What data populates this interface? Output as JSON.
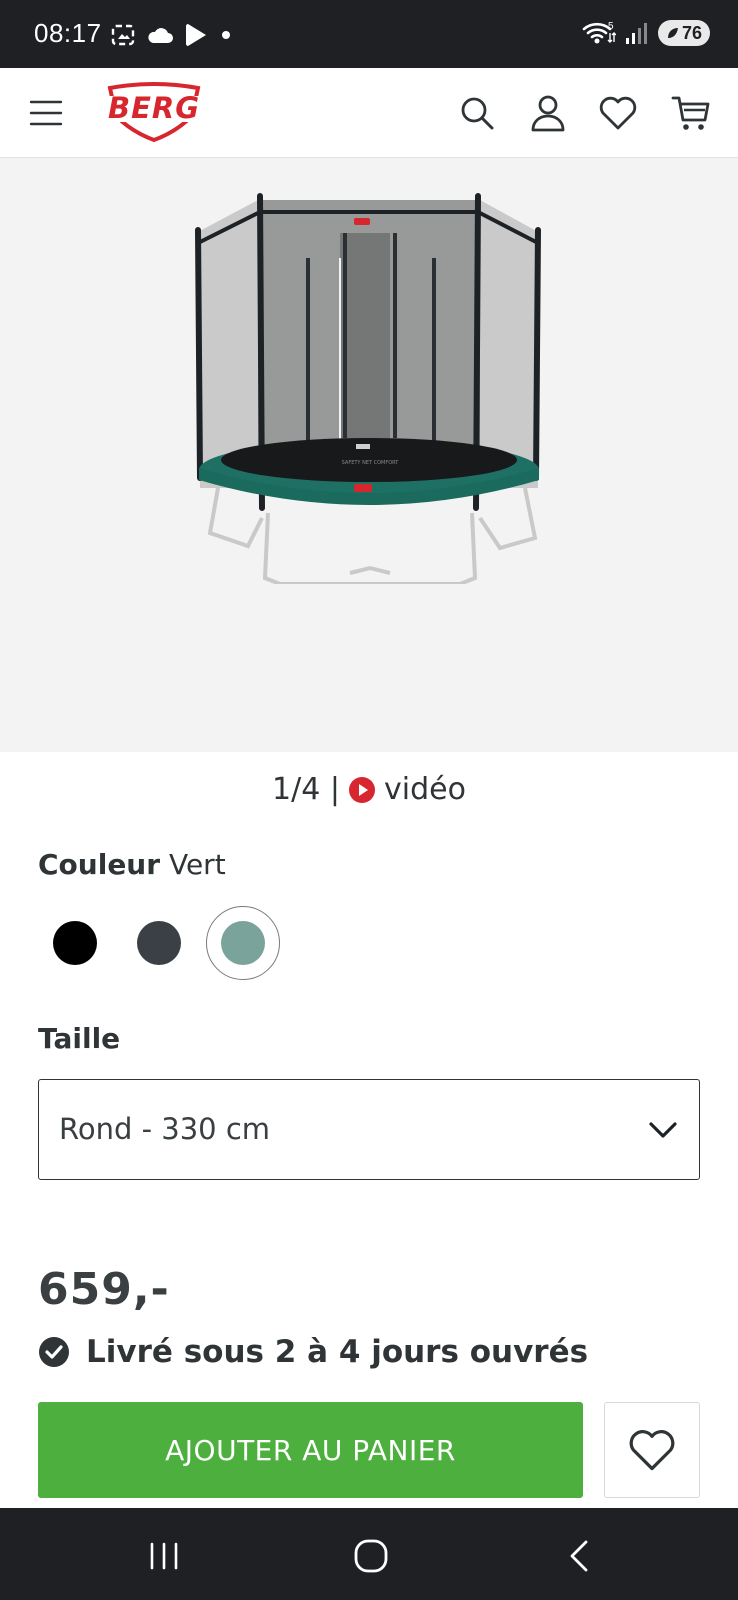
{
  "status_bar": {
    "time": "08:17",
    "battery": "76",
    "icons": [
      "screenshot-icon",
      "cloud-icon",
      "play-store-icon",
      "dot-icon",
      "wifi-icon",
      "signal-icon",
      "battery-icon"
    ]
  },
  "header": {
    "logo_text": "BERG",
    "icons": [
      "menu-icon",
      "search-icon",
      "account-icon",
      "heart-icon",
      "cart-icon"
    ]
  },
  "gallery": {
    "counter": "1/4 |",
    "video_label": "vidéo"
  },
  "color": {
    "label": "Couleur",
    "value": "Vert",
    "swatches": [
      {
        "name": "Noir",
        "hex": "#000000"
      },
      {
        "name": "Gris",
        "hex": "#3a4045"
      },
      {
        "name": "Vert",
        "hex": "#7aa39b",
        "selected": true
      }
    ]
  },
  "size": {
    "label": "Taille",
    "selected": "Rond - 330 cm"
  },
  "price": "659,-",
  "delivery": "Livré sous 2 à 4 jours ouvrés",
  "cta": {
    "add_to_cart": "AJOUTER AU PANIER"
  },
  "colors": {
    "brand_red": "#d7262d",
    "cta_green": "#4caf3e",
    "text": "#2f3437"
  }
}
